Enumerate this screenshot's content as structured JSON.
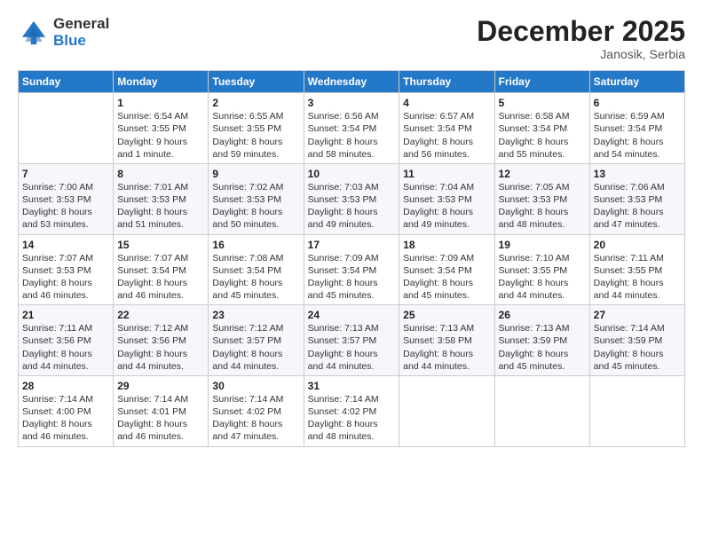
{
  "logo": {
    "general": "General",
    "blue": "Blue"
  },
  "header": {
    "month": "December 2025",
    "location": "Janosik, Serbia"
  },
  "weekdays": [
    "Sunday",
    "Monday",
    "Tuesday",
    "Wednesday",
    "Thursday",
    "Friday",
    "Saturday"
  ],
  "weeks": [
    [
      {
        "day": "",
        "info": ""
      },
      {
        "day": "1",
        "info": "Sunrise: 6:54 AM\nSunset: 3:55 PM\nDaylight: 9 hours\nand 1 minute."
      },
      {
        "day": "2",
        "info": "Sunrise: 6:55 AM\nSunset: 3:55 PM\nDaylight: 8 hours\nand 59 minutes."
      },
      {
        "day": "3",
        "info": "Sunrise: 6:56 AM\nSunset: 3:54 PM\nDaylight: 8 hours\nand 58 minutes."
      },
      {
        "day": "4",
        "info": "Sunrise: 6:57 AM\nSunset: 3:54 PM\nDaylight: 8 hours\nand 56 minutes."
      },
      {
        "day": "5",
        "info": "Sunrise: 6:58 AM\nSunset: 3:54 PM\nDaylight: 8 hours\nand 55 minutes."
      },
      {
        "day": "6",
        "info": "Sunrise: 6:59 AM\nSunset: 3:54 PM\nDaylight: 8 hours\nand 54 minutes."
      }
    ],
    [
      {
        "day": "7",
        "info": "Sunrise: 7:00 AM\nSunset: 3:53 PM\nDaylight: 8 hours\nand 53 minutes."
      },
      {
        "day": "8",
        "info": "Sunrise: 7:01 AM\nSunset: 3:53 PM\nDaylight: 8 hours\nand 51 minutes."
      },
      {
        "day": "9",
        "info": "Sunrise: 7:02 AM\nSunset: 3:53 PM\nDaylight: 8 hours\nand 50 minutes."
      },
      {
        "day": "10",
        "info": "Sunrise: 7:03 AM\nSunset: 3:53 PM\nDaylight: 8 hours\nand 49 minutes."
      },
      {
        "day": "11",
        "info": "Sunrise: 7:04 AM\nSunset: 3:53 PM\nDaylight: 8 hours\nand 49 minutes."
      },
      {
        "day": "12",
        "info": "Sunrise: 7:05 AM\nSunset: 3:53 PM\nDaylight: 8 hours\nand 48 minutes."
      },
      {
        "day": "13",
        "info": "Sunrise: 7:06 AM\nSunset: 3:53 PM\nDaylight: 8 hours\nand 47 minutes."
      }
    ],
    [
      {
        "day": "14",
        "info": "Sunrise: 7:07 AM\nSunset: 3:53 PM\nDaylight: 8 hours\nand 46 minutes."
      },
      {
        "day": "15",
        "info": "Sunrise: 7:07 AM\nSunset: 3:54 PM\nDaylight: 8 hours\nand 46 minutes."
      },
      {
        "day": "16",
        "info": "Sunrise: 7:08 AM\nSunset: 3:54 PM\nDaylight: 8 hours\nand 45 minutes."
      },
      {
        "day": "17",
        "info": "Sunrise: 7:09 AM\nSunset: 3:54 PM\nDaylight: 8 hours\nand 45 minutes."
      },
      {
        "day": "18",
        "info": "Sunrise: 7:09 AM\nSunset: 3:54 PM\nDaylight: 8 hours\nand 45 minutes."
      },
      {
        "day": "19",
        "info": "Sunrise: 7:10 AM\nSunset: 3:55 PM\nDaylight: 8 hours\nand 44 minutes."
      },
      {
        "day": "20",
        "info": "Sunrise: 7:11 AM\nSunset: 3:55 PM\nDaylight: 8 hours\nand 44 minutes."
      }
    ],
    [
      {
        "day": "21",
        "info": "Sunrise: 7:11 AM\nSunset: 3:56 PM\nDaylight: 8 hours\nand 44 minutes."
      },
      {
        "day": "22",
        "info": "Sunrise: 7:12 AM\nSunset: 3:56 PM\nDaylight: 8 hours\nand 44 minutes."
      },
      {
        "day": "23",
        "info": "Sunrise: 7:12 AM\nSunset: 3:57 PM\nDaylight: 8 hours\nand 44 minutes."
      },
      {
        "day": "24",
        "info": "Sunrise: 7:13 AM\nSunset: 3:57 PM\nDaylight: 8 hours\nand 44 minutes."
      },
      {
        "day": "25",
        "info": "Sunrise: 7:13 AM\nSunset: 3:58 PM\nDaylight: 8 hours\nand 44 minutes."
      },
      {
        "day": "26",
        "info": "Sunrise: 7:13 AM\nSunset: 3:59 PM\nDaylight: 8 hours\nand 45 minutes."
      },
      {
        "day": "27",
        "info": "Sunrise: 7:14 AM\nSunset: 3:59 PM\nDaylight: 8 hours\nand 45 minutes."
      }
    ],
    [
      {
        "day": "28",
        "info": "Sunrise: 7:14 AM\nSunset: 4:00 PM\nDaylight: 8 hours\nand 46 minutes."
      },
      {
        "day": "29",
        "info": "Sunrise: 7:14 AM\nSunset: 4:01 PM\nDaylight: 8 hours\nand 46 minutes."
      },
      {
        "day": "30",
        "info": "Sunrise: 7:14 AM\nSunset: 4:02 PM\nDaylight: 8 hours\nand 47 minutes."
      },
      {
        "day": "31",
        "info": "Sunrise: 7:14 AM\nSunset: 4:02 PM\nDaylight: 8 hours\nand 48 minutes."
      },
      {
        "day": "",
        "info": ""
      },
      {
        "day": "",
        "info": ""
      },
      {
        "day": "",
        "info": ""
      }
    ]
  ]
}
